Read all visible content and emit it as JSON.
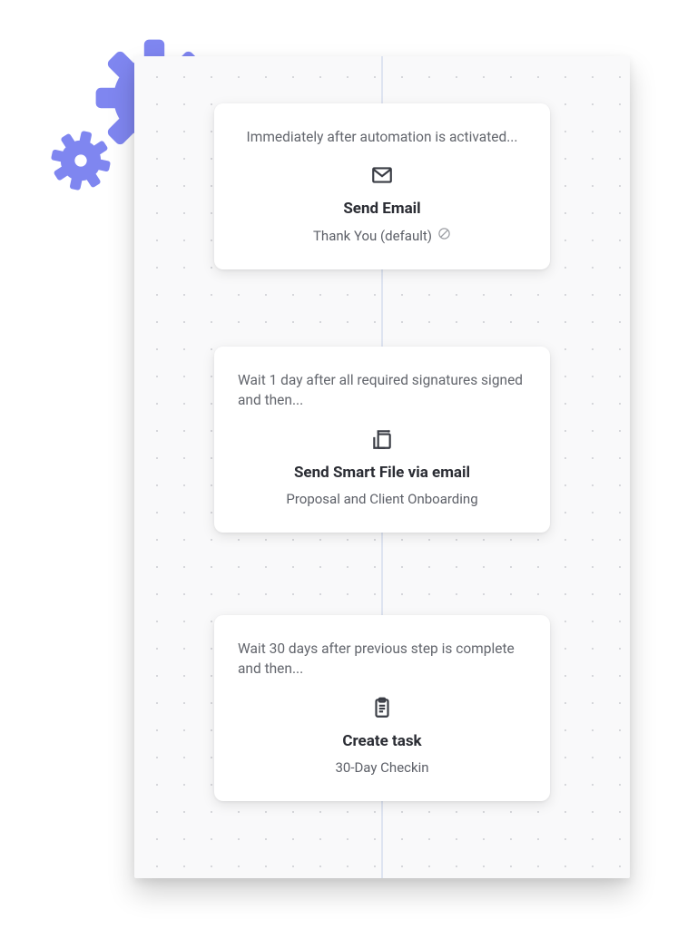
{
  "decor": {
    "gear_large_name": "gear-icon",
    "gear_small_name": "gear-icon"
  },
  "steps": [
    {
      "trigger": "Immediately after automation is activated...",
      "action_title": "Send Email",
      "detail": "Thank You (default)",
      "icon": "mail-icon",
      "has_detail_glyph": true
    },
    {
      "trigger": "Wait 1 day after all required signatures signed and then...",
      "action_title": "Send Smart File via email",
      "detail": "Proposal and Client Onboarding",
      "icon": "smart-file-icon",
      "has_detail_glyph": false
    },
    {
      "trigger": "Wait 30 days after previous step is complete and then...",
      "action_title": "Create task",
      "detail": "30-Day Checkin",
      "icon": "clipboard-icon",
      "has_detail_glyph": false
    }
  ]
}
